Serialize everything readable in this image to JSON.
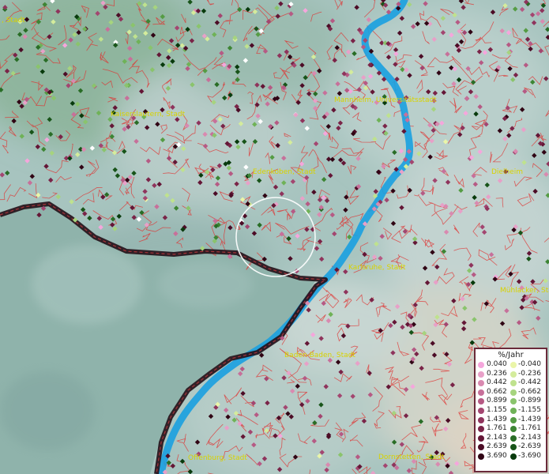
{
  "map": {
    "cities": [
      {
        "id": "city-stadt-top-left",
        "label": ", Stadt"
      },
      {
        "id": "city-kaiserslautern",
        "label": "Kaiserslautern, Stadt"
      },
      {
        "id": "city-mannheim",
        "label": "Mannheim, Universitätsstadt"
      },
      {
        "id": "city-edenkoben",
        "label": "Edenkoben, Stadt"
      },
      {
        "id": "city-dielheim",
        "label": "Dielheim"
      },
      {
        "id": "city-karlsruhe",
        "label": "Karlsruhe, Stadt"
      },
      {
        "id": "city-muehlacker",
        "label": "Mühlacker, Sta"
      },
      {
        "id": "city-baden-baden",
        "label": "Baden-Baden, Stadt"
      },
      {
        "id": "city-offenburg",
        "label": "Offenburg, Stadt"
      },
      {
        "id": "city-dornstetten",
        "label": "Dornstetten, Stadt"
      }
    ]
  },
  "legend": {
    "title": "%/Jahr",
    "rows": [
      {
        "pos": "0.040",
        "neg": "-0.040",
        "pos_color": "#f5a6dc",
        "neg_color": "#eaf5a8"
      },
      {
        "pos": "0.236",
        "neg": "-0.236",
        "pos_color": "#e8a0c8",
        "neg_color": "#d4ec9c"
      },
      {
        "pos": "0.442",
        "neg": "-0.442",
        "pos_color": "#d98ab0",
        "neg_color": "#bfe28e"
      },
      {
        "pos": "0.662",
        "neg": "-0.662",
        "pos_color": "#c7709a",
        "neg_color": "#a6d47e"
      },
      {
        "pos": "0.899",
        "neg": "-0.899",
        "pos_color": "#b65a84",
        "neg_color": "#8ac46c"
      },
      {
        "pos": "1.155",
        "neg": "-1.155",
        "pos_color": "#a34670",
        "neg_color": "#6fb257"
      },
      {
        "pos": "1.439",
        "neg": "-1.439",
        "pos_color": "#8f345c",
        "neg_color": "#559c44"
      },
      {
        "pos": "1.761",
        "neg": "-1.761",
        "pos_color": "#7a2448",
        "neg_color": "#3d8534"
      },
      {
        "pos": "2.143",
        "neg": "-2.143",
        "pos_color": "#641636",
        "neg_color": "#296d26"
      },
      {
        "pos": "2.639",
        "neg": "-2.639",
        "pos_color": "#4c0c26",
        "neg_color": "#185419"
      },
      {
        "pos": "3.690",
        "neg": "-3.690",
        "pos_color": "#300414",
        "neg_color": "#083a0c"
      }
    ]
  },
  "colors": {
    "boundary": "#e0302f",
    "river": "#1aa0e0",
    "border": "#1a0a10",
    "label": "#d8d200",
    "outside_area": "#8fb3ab",
    "lowland": "#a9c9c4"
  }
}
